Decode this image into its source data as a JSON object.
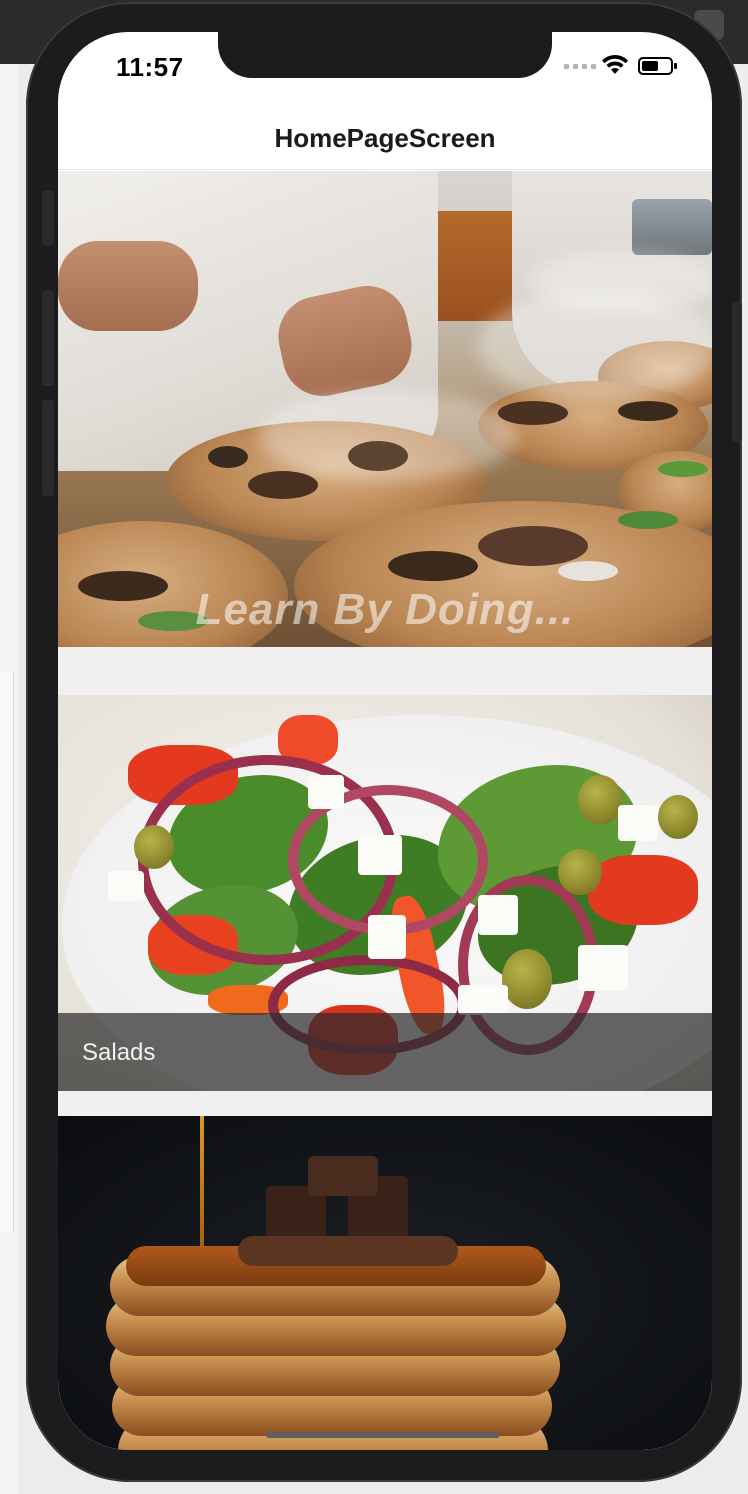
{
  "status_bar": {
    "time": "11:57"
  },
  "navbar": {
    "title": "HomePageScreen"
  },
  "feed": {
    "hero": {
      "caption": "Learn By Doing..."
    },
    "cards": [
      {
        "label": "Salads"
      },
      {
        "label": ""
      }
    ]
  },
  "colors": {
    "nav_bg": "#ffffff",
    "feed_bg": "#f0f0f0",
    "caption_bar": "#2d2d2d",
    "phone_frame": "#1c1c1e"
  },
  "icons": [
    "signal-dots-icon",
    "wifi-icon",
    "battery-icon"
  ]
}
